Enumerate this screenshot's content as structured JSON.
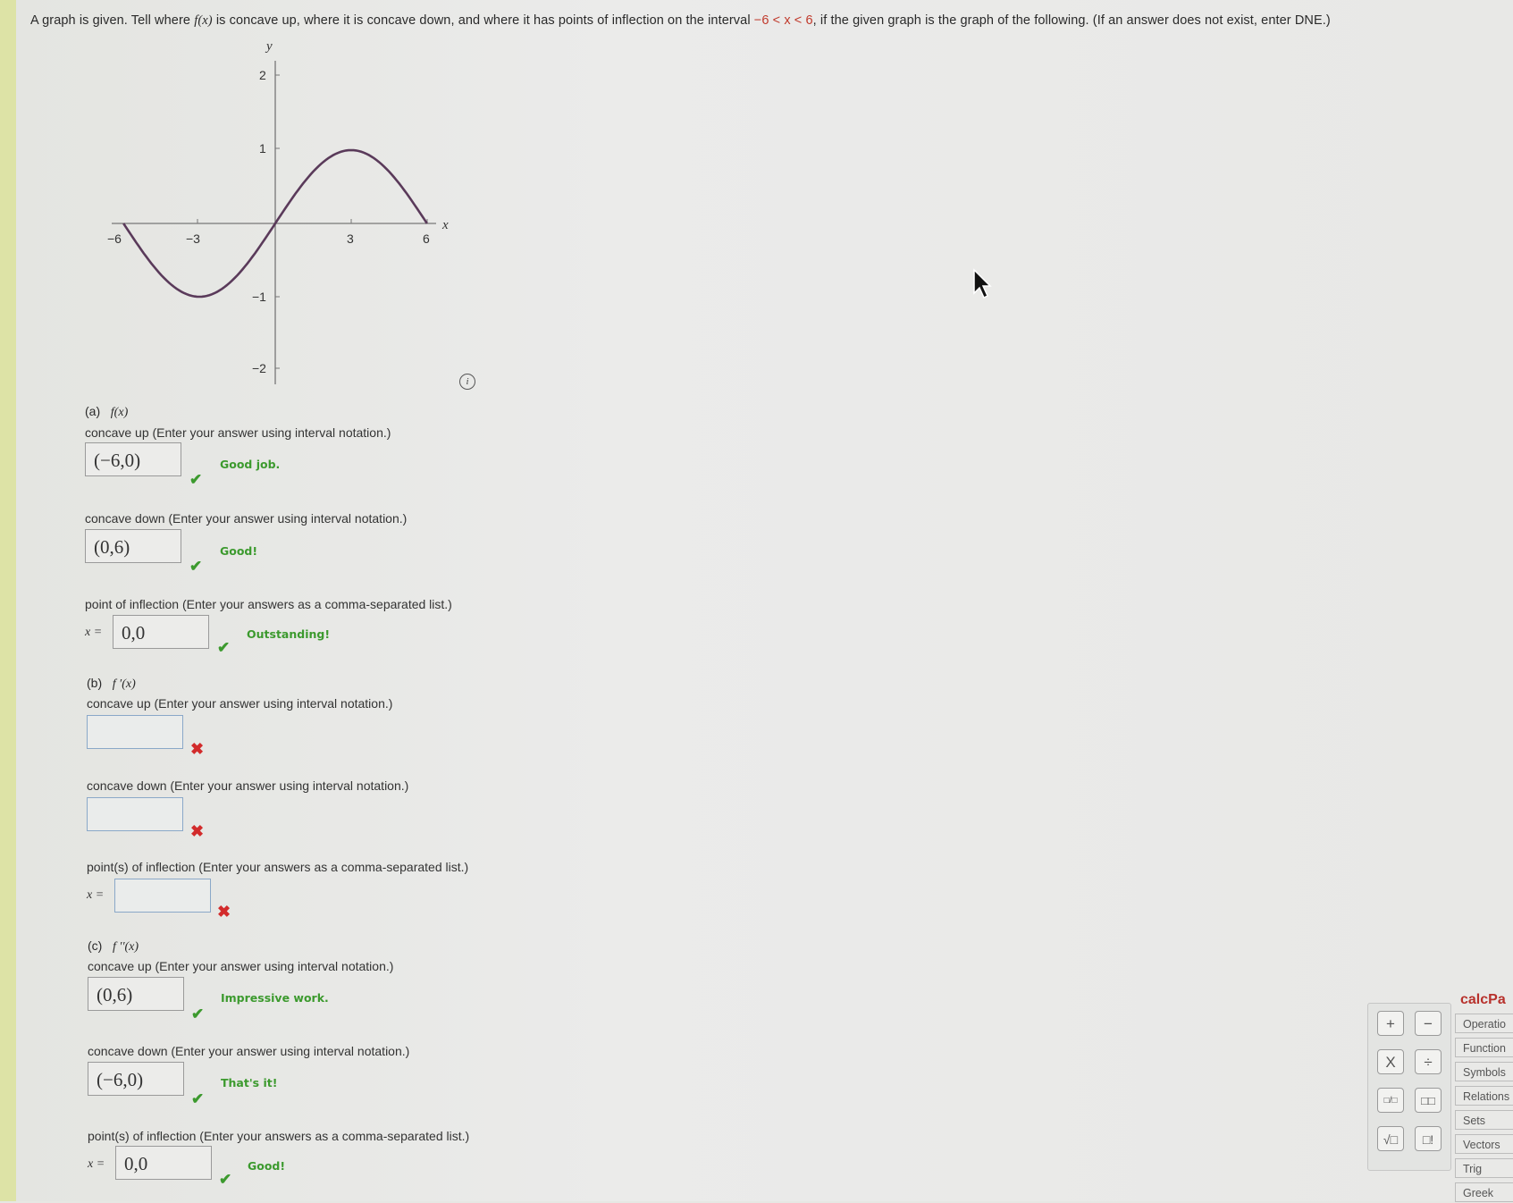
{
  "problem": {
    "prompt_before": "A graph is given. Tell where ",
    "prompt_fx": "f(x)",
    "prompt_mid": " is concave up, where it is concave down, and where it has points of inflection on the interval ",
    "prompt_interval": "−6 < x < 6",
    "prompt_after": ", if the given graph is the graph of the following. (If an answer does not exist, enter DNE.)"
  },
  "graph": {
    "x_axis_label": "x",
    "y_axis_label": "y",
    "x_ticks": [
      "−6",
      "−3",
      "3",
      "6"
    ],
    "y_ticks": [
      "2",
      "1",
      "−1",
      "−2"
    ],
    "curve": "sine-like curve from (−6,0) through min near (−3,−1), origin, max near (3,1), to (6,0)"
  },
  "info_icon": "info-icon",
  "parts": [
    {
      "label": "(a)",
      "func": "f(x)",
      "concave_up_q": "concave up (Enter your answer using interval notation.)",
      "concave_up_value": "(−6,0)",
      "concave_up_feedback": "Good job.",
      "concave_up_status": "correct",
      "concave_down_q": "concave down (Enter your answer using interval notation.)",
      "concave_down_value": "(0,6)",
      "concave_down_feedback": "Good!",
      "concave_down_status": "correct",
      "inflection_q": "point of inflection (Enter your answers as a comma-separated list.)",
      "x_eq": "x =",
      "inflection_value": "0,0",
      "inflection_feedback": "Outstanding!",
      "inflection_status": "correct"
    },
    {
      "label": "(b)",
      "func": "f ′(x)",
      "concave_up_q": "concave up (Enter your answer using interval notation.)",
      "concave_up_value": "",
      "concave_up_status": "incorrect",
      "concave_down_q": "concave down (Enter your answer using interval notation.)",
      "concave_down_value": "",
      "concave_down_status": "incorrect",
      "inflection_q": "point(s) of inflection (Enter your answers as a comma-separated list.)",
      "x_eq": "x =",
      "inflection_value": "",
      "inflection_status": "incorrect"
    },
    {
      "label": "(c)",
      "func": "f ′′(x)",
      "concave_up_q": "concave up (Enter your answer using interval notation.)",
      "concave_up_value": "(0,6)",
      "concave_up_feedback": "Impressive work.",
      "concave_up_status": "correct",
      "concave_down_q": "concave down (Enter your answer using interval notation.)",
      "concave_down_value": "(−6,0)",
      "concave_down_feedback": "That's it!",
      "concave_down_status": "correct",
      "inflection_q": "point(s) of inflection (Enter your answers as a comma-separated list.)",
      "x_eq": "x =",
      "inflection_value": "0,0",
      "inflection_feedback": "Good!",
      "inflection_status": "correct"
    }
  ],
  "marks": {
    "check": "✔",
    "cross": "✖"
  },
  "calcpad": {
    "title_visible": "calcPa",
    "buttons": [
      "+",
      "−",
      "X",
      "÷",
      "□/□",
      "□□",
      "√□",
      "□!"
    ],
    "menu": [
      "Operatio",
      "Function",
      "Symbols",
      "Relations",
      "Sets",
      "Vectors",
      "Trig",
      "Greek"
    ]
  },
  "colors": {
    "correct": "#3c9a2e",
    "incorrect": "#d22b2b",
    "curve": "#5a3a5a",
    "interval_red": "#c0392b"
  }
}
